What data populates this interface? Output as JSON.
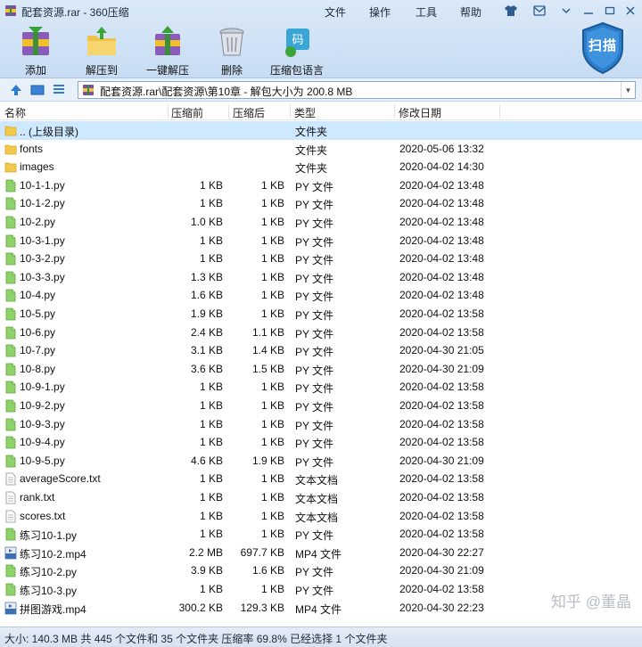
{
  "window": {
    "title": "配套资源.rar - 360压缩",
    "menu": {
      "file": "文件",
      "ops": "操作",
      "tools": "工具",
      "help": "帮助"
    }
  },
  "toolbar": {
    "add": "添加",
    "extract_to": "解压到",
    "one_click_extract": "一键解压",
    "delete": "删除",
    "code_language": "压缩包语言",
    "scan": "扫描"
  },
  "address": {
    "path": "配套资源.rar\\配套资源\\第10章 - 解包大小为 200.8 MB"
  },
  "columns": {
    "name": "名称",
    "original": "压缩前",
    "compressed": "压缩后",
    "type": "类型",
    "modified": "修改日期"
  },
  "files": [
    {
      "name": ".. (上级目录)",
      "orig": "",
      "comp": "",
      "type": "文件夹",
      "date": "",
      "icon": "folder-icon"
    },
    {
      "name": "fonts",
      "orig": "",
      "comp": "",
      "type": "文件夹",
      "date": "2020-05-06 13:32",
      "icon": "folder-icon"
    },
    {
      "name": "images",
      "orig": "",
      "comp": "",
      "type": "文件夹",
      "date": "2020-04-02 14:30",
      "icon": "folder-icon"
    },
    {
      "name": "10-1-1.py",
      "orig": "1 KB",
      "comp": "1 KB",
      "type": "PY 文件",
      "date": "2020-04-02 13:48",
      "icon": "py-file-icon"
    },
    {
      "name": "10-1-2.py",
      "orig": "1 KB",
      "comp": "1 KB",
      "type": "PY 文件",
      "date": "2020-04-02 13:48",
      "icon": "py-file-icon"
    },
    {
      "name": "10-2.py",
      "orig": "1.0 KB",
      "comp": "1 KB",
      "type": "PY 文件",
      "date": "2020-04-02 13:48",
      "icon": "py-file-icon"
    },
    {
      "name": "10-3-1.py",
      "orig": "1 KB",
      "comp": "1 KB",
      "type": "PY 文件",
      "date": "2020-04-02 13:48",
      "icon": "py-file-icon"
    },
    {
      "name": "10-3-2.py",
      "orig": "1 KB",
      "comp": "1 KB",
      "type": "PY 文件",
      "date": "2020-04-02 13:48",
      "icon": "py-file-icon"
    },
    {
      "name": "10-3-3.py",
      "orig": "1.3 KB",
      "comp": "1 KB",
      "type": "PY 文件",
      "date": "2020-04-02 13:48",
      "icon": "py-file-icon"
    },
    {
      "name": "10-4.py",
      "orig": "1.6 KB",
      "comp": "1 KB",
      "type": "PY 文件",
      "date": "2020-04-02 13:48",
      "icon": "py-file-icon"
    },
    {
      "name": "10-5.py",
      "orig": "1.9 KB",
      "comp": "1 KB",
      "type": "PY 文件",
      "date": "2020-04-02 13:58",
      "icon": "py-file-icon"
    },
    {
      "name": "10-6.py",
      "orig": "2.4 KB",
      "comp": "1.1 KB",
      "type": "PY 文件",
      "date": "2020-04-02 13:58",
      "icon": "py-file-icon"
    },
    {
      "name": "10-7.py",
      "orig": "3.1 KB",
      "comp": "1.4 KB",
      "type": "PY 文件",
      "date": "2020-04-30 21:05",
      "icon": "py-file-icon"
    },
    {
      "name": "10-8.py",
      "orig": "3.6 KB",
      "comp": "1.5 KB",
      "type": "PY 文件",
      "date": "2020-04-30 21:09",
      "icon": "py-file-icon"
    },
    {
      "name": "10-9-1.py",
      "orig": "1 KB",
      "comp": "1 KB",
      "type": "PY 文件",
      "date": "2020-04-02 13:58",
      "icon": "py-file-icon"
    },
    {
      "name": "10-9-2.py",
      "orig": "1 KB",
      "comp": "1 KB",
      "type": "PY 文件",
      "date": "2020-04-02 13:58",
      "icon": "py-file-icon"
    },
    {
      "name": "10-9-3.py",
      "orig": "1 KB",
      "comp": "1 KB",
      "type": "PY 文件",
      "date": "2020-04-02 13:58",
      "icon": "py-file-icon"
    },
    {
      "name": "10-9-4.py",
      "orig": "1 KB",
      "comp": "1 KB",
      "type": "PY 文件",
      "date": "2020-04-02 13:58",
      "icon": "py-file-icon"
    },
    {
      "name": "10-9-5.py",
      "orig": "4.6 KB",
      "comp": "1.9 KB",
      "type": "PY 文件",
      "date": "2020-04-30 21:09",
      "icon": "py-file-icon"
    },
    {
      "name": "averageScore.txt",
      "orig": "1 KB",
      "comp": "1 KB",
      "type": "文本文档",
      "date": "2020-04-02 13:58",
      "icon": "txt-file-icon"
    },
    {
      "name": "rank.txt",
      "orig": "1 KB",
      "comp": "1 KB",
      "type": "文本文档",
      "date": "2020-04-02 13:58",
      "icon": "txt-file-icon"
    },
    {
      "name": "scores.txt",
      "orig": "1 KB",
      "comp": "1 KB",
      "type": "文本文档",
      "date": "2020-04-02 13:58",
      "icon": "txt-file-icon"
    },
    {
      "name": "练习10-1.py",
      "orig": "1 KB",
      "comp": "1 KB",
      "type": "PY 文件",
      "date": "2020-04-02 13:58",
      "icon": "py-file-icon"
    },
    {
      "name": "练习10-2.mp4",
      "orig": "2.2 MB",
      "comp": "697.7 KB",
      "type": "MP4 文件",
      "date": "2020-04-30 22:27",
      "icon": "mp4-file-icon"
    },
    {
      "name": "练习10-2.py",
      "orig": "3.9 KB",
      "comp": "1.6 KB",
      "type": "PY 文件",
      "date": "2020-04-30 21:09",
      "icon": "py-file-icon"
    },
    {
      "name": "练习10-3.py",
      "orig": "1 KB",
      "comp": "1 KB",
      "type": "PY 文件",
      "date": "2020-04-02 13:58",
      "icon": "py-file-icon"
    },
    {
      "name": "拼图游戏.mp4",
      "orig": "300.2 KB",
      "comp": "129.3 KB",
      "type": "MP4 文件",
      "date": "2020-04-30 22:23",
      "icon": "mp4-file-icon"
    }
  ],
  "watermark": "知乎 @董晶",
  "status": "大小: 140.3 MB 共 445 个文件和 35 个文件夹 压缩率 69.8% 已经选择 1 个文件夹"
}
